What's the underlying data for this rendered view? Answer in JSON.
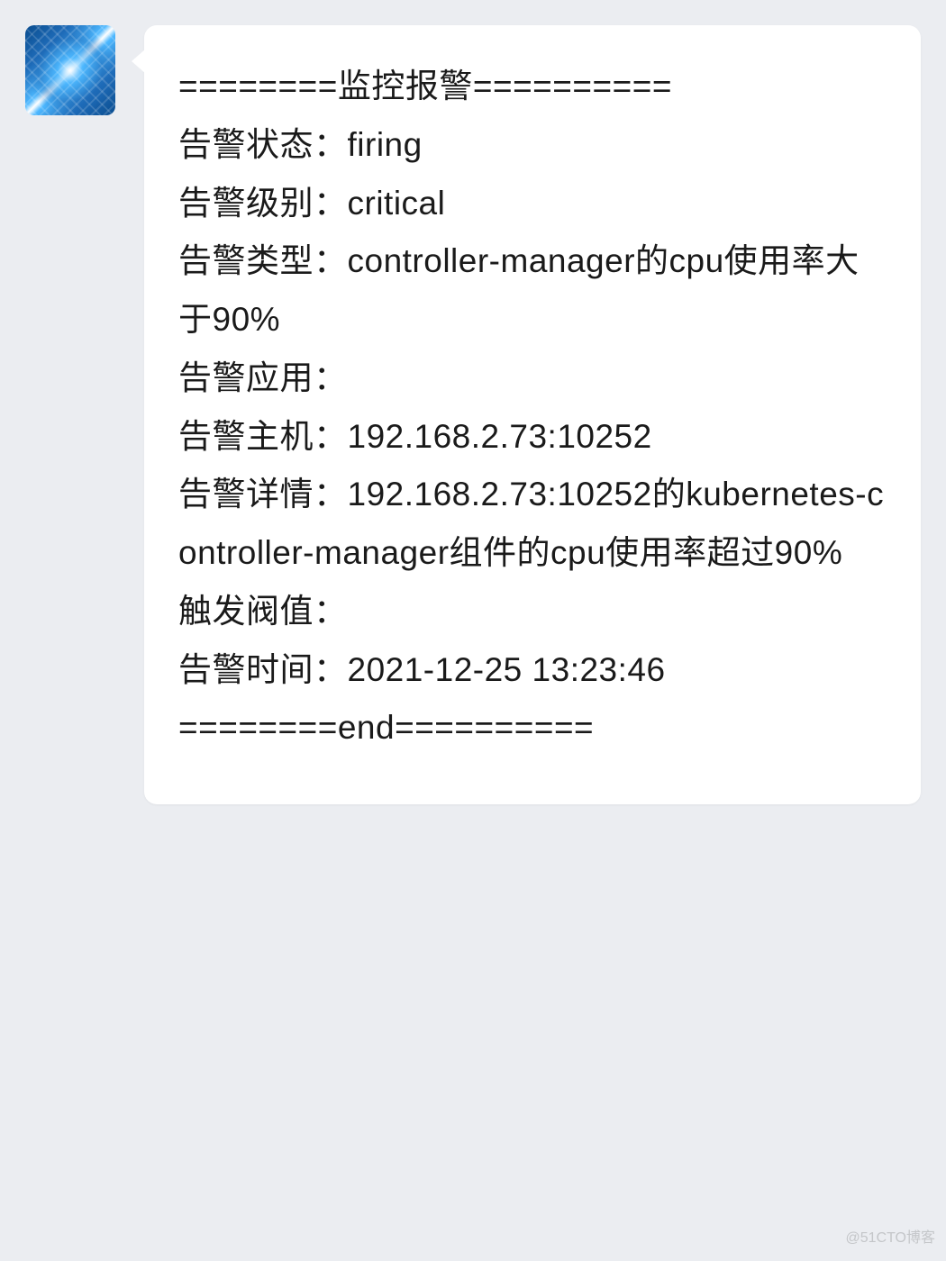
{
  "message": {
    "header": "========监控报警==========",
    "status_label": "告警状态：",
    "status_value": "firing",
    "level_label": "告警级别：",
    "level_value": "critical",
    "type_label": "告警类型：",
    "type_value": "controller-manager的cpu使用率大于90%",
    "app_label": "告警应用：",
    "app_value": "",
    "host_label": "告警主机：",
    "host_value": "192.168.2.73:10252",
    "detail_label": "告警详情：",
    "detail_value": "192.168.2.73:10252的kubernetes-controller-manager组件的cpu使用率超过90%",
    "threshold_label": "触发阀值：",
    "threshold_value": "",
    "time_label": "告警时间：",
    "time_value": "2021-12-25 13:23:46",
    "footer": "========end=========="
  },
  "watermark": "@51CTO博客"
}
